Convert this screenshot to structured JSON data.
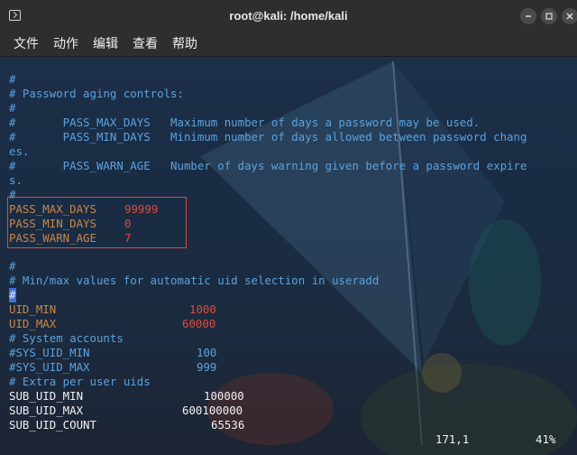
{
  "window": {
    "title": "root@kali: /home/kali",
    "icon": "terminal-icon"
  },
  "menu": {
    "items": [
      "文件",
      "动作",
      "编辑",
      "查看",
      "帮助"
    ]
  },
  "lines": {
    "l1": "#",
    "l2": "# Password aging controls:",
    "l3": "#",
    "l4": "#       PASS_MAX_DAYS   Maximum number of days a password may be used.",
    "l5": "#       PASS_MIN_DAYS   Minimum number of days allowed between password chang",
    "l6": "es.",
    "l7": "#       PASS_WARN_AGE   Number of days warning given before a password expire",
    "l8": "s.",
    "l9": "#",
    "l10": "#",
    "l11": "# Min/max values for automatic uid selection in useradd",
    "l12": "#",
    "l13": "# System accounts",
    "l14": "# Extra per user uids"
  },
  "config": {
    "pass_max_days": {
      "key": "PASS_MAX_DAYS",
      "value": "99999"
    },
    "pass_min_days": {
      "key": "PASS_MIN_DAYS",
      "value": "0"
    },
    "pass_warn_age": {
      "key": "PASS_WARN_AGE",
      "value": "7"
    },
    "uid_min": {
      "key": "UID_MIN",
      "value": "1000"
    },
    "uid_max": {
      "key": "UID_MAX",
      "value": "60000"
    },
    "sys_uid_min": {
      "key": "#SYS_UID_MIN",
      "value": "100"
    },
    "sys_uid_max": {
      "key": "#SYS_UID_MAX",
      "value": "999"
    },
    "sub_uid_min": {
      "key": "SUB_UID_MIN",
      "value": "100000"
    },
    "sub_uid_max": {
      "key": "SUB_UID_MAX",
      "value": "600100000"
    },
    "sub_uid_count": {
      "key": "SUB_UID_COUNT",
      "value": "65536"
    }
  },
  "status": {
    "position": "171,1",
    "percent": "41%"
  },
  "colors": {
    "comment": "#5aa2e0",
    "key": "#c8874a",
    "value": "#e0493a",
    "highlight_box": "#e0483d",
    "cursor": "#3d6fd9"
  }
}
